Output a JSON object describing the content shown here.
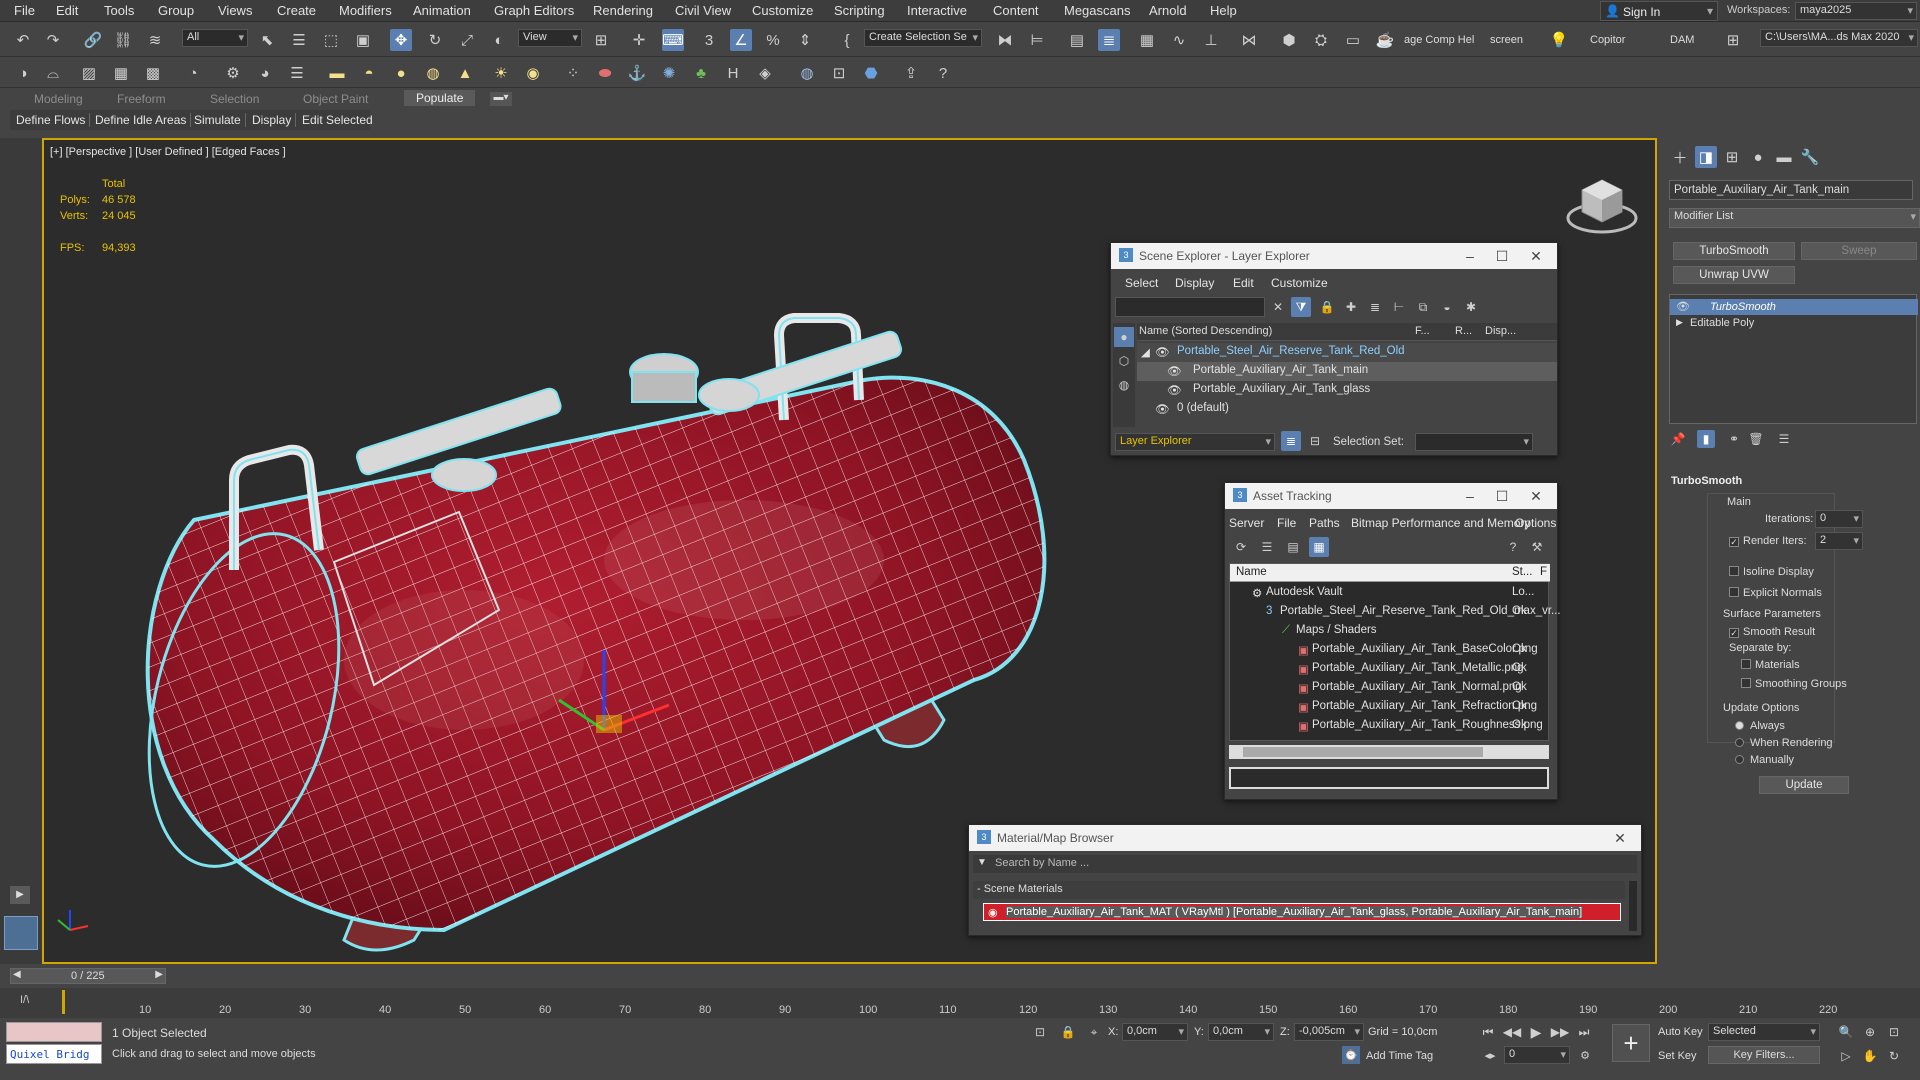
{
  "menu": [
    "File",
    "Edit",
    "Tools",
    "Group",
    "Views",
    "Create",
    "Modifiers",
    "Animation",
    "Graph Editors",
    "Rendering",
    "Civil View",
    "Customize",
    "Scripting",
    "Interactive",
    "Content",
    "Megascans",
    "Arnold",
    "Help"
  ],
  "account": {
    "sign_in": "Sign In",
    "workspaces_label": "Workspaces:",
    "workspace": "maya2025"
  },
  "toolbar": {
    "filter": "All",
    "ref_coord": "View",
    "selection_set": "Create Selection Se",
    "labels": [
      "age Comp Hel",
      "screen",
      "Copitor",
      "DAM"
    ],
    "path": "C:\\Users\\MA...ds Max 2020"
  },
  "ribbon_tabs": [
    "Modeling",
    "Freeform",
    "Selection",
    "Object Paint",
    "Populate"
  ],
  "populate_tabs": [
    "Define Flows",
    "Define Idle Areas",
    "Simulate",
    "Display",
    "Edit Selected"
  ],
  "viewport": {
    "label": "[+] [Perspective ] [User Defined ] [Edged Faces ]",
    "stats": {
      "total_label": "Total",
      "polys_label": "Polys:",
      "polys": "46 578",
      "verts_label": "Verts:",
      "verts": "24 045",
      "fps_label": "FPS:",
      "fps": "94,393"
    }
  },
  "scene_explorer": {
    "title": "Scene Explorer - Layer Explorer",
    "menu": [
      "Select",
      "Display",
      "Edit",
      "Customize"
    ],
    "columns": [
      "Name (Sorted Descending)",
      "F...",
      "R...",
      "Disp..."
    ],
    "rows": [
      "Portable_Steel_Air_Reserve_Tank_Red_Old",
      "Portable_Auxiliary_Air_Tank_main",
      "Portable_Auxiliary_Air_Tank_glass",
      "0 (default)"
    ],
    "footer_mode": "Layer Explorer",
    "selection_set_label": "Selection Set:"
  },
  "asset_tracking": {
    "title": "Asset Tracking",
    "menu": [
      "Server",
      "File",
      "Paths",
      "Bitmap Performance and Memory",
      "Options"
    ],
    "columns": [
      "Name",
      "St...",
      "F"
    ],
    "rows": [
      {
        "name": "Autodesk Vault",
        "status": "Lo..."
      },
      {
        "name": "Portable_Steel_Air_Reserve_Tank_Red_Old_max_vr...",
        "status": "Ok"
      },
      {
        "name": "Maps / Shaders",
        "status": ""
      },
      {
        "name": "Portable_Auxiliary_Air_Tank_BaseColor.png",
        "status": "Ok"
      },
      {
        "name": "Portable_Auxiliary_Air_Tank_Metallic.png",
        "status": "Ok"
      },
      {
        "name": "Portable_Auxiliary_Air_Tank_Normal.png",
        "status": "Ok"
      },
      {
        "name": "Portable_Auxiliary_Air_Tank_Refraction.png",
        "status": "Ok"
      },
      {
        "name": "Portable_Auxiliary_Air_Tank_Roughness.png",
        "status": "Ok"
      }
    ]
  },
  "material_browser": {
    "title": "Material/Map Browser",
    "search_placeholder": "Search by Name ...",
    "section": "- Scene Materials",
    "material": "Portable_Auxiliary_Air_Tank_MAT ( VRayMtl ) [Portable_Auxiliary_Air_Tank_glass, Portable_Auxiliary_Air_Tank_main]"
  },
  "command_panel": {
    "object_name": "Portable_Auxiliary_Air_Tank_main",
    "modifier_list": "Modifier List",
    "buttons": [
      "TurboSmooth",
      "Sweep",
      "Unwrap UVW"
    ],
    "stack": [
      "TurboSmooth",
      "Editable Poly"
    ],
    "rollout": "TurboSmooth",
    "main_label": "Main",
    "iterations_label": "Iterations:",
    "iterations": "0",
    "render_iters_label": "Render Iters:",
    "render_iters": "2",
    "isoline": "Isoline Display",
    "explicit": "Explicit Normals",
    "surface_params": "Surface Parameters",
    "smooth_result": "Smooth Result",
    "separate_by": "Separate by:",
    "materials": "Materials",
    "smoothing_groups": "Smoothing Groups",
    "update_options": "Update Options",
    "always": "Always",
    "when_rendering": "When Rendering",
    "manually": "Manually",
    "update_btn": "Update"
  },
  "timeline": {
    "frame_counter": "0 / 225",
    "ticks": [
      "10",
      "20",
      "30",
      "40",
      "50",
      "60",
      "70",
      "80",
      "90",
      "100",
      "110",
      "120",
      "130",
      "140",
      "150",
      "160",
      "170",
      "180",
      "190",
      "200",
      "210",
      "220"
    ]
  },
  "status": {
    "quixel": "Quixel Bridg",
    "selected": "1 Object Selected",
    "hint": "Click and drag to select and move objects",
    "x_label": "X:",
    "x": "0,0cm",
    "y_label": "Y:",
    "y": "0,0cm",
    "z_label": "Z:",
    "z": "-0,005cm",
    "grid": "Grid = 10,0cm",
    "add_time_tag": "Add Time Tag",
    "auto_key": "Auto Key",
    "set_key": "Set Key",
    "key_mode": "Selected",
    "key_filters": "Key Filters...",
    "frame": "0"
  },
  "colors": {
    "accent": "#5a7fb0",
    "viewport_border": "#d0a600",
    "tank_red": "#a8192b",
    "wire": "#ffffff",
    "selection": "#7fe3f0"
  }
}
